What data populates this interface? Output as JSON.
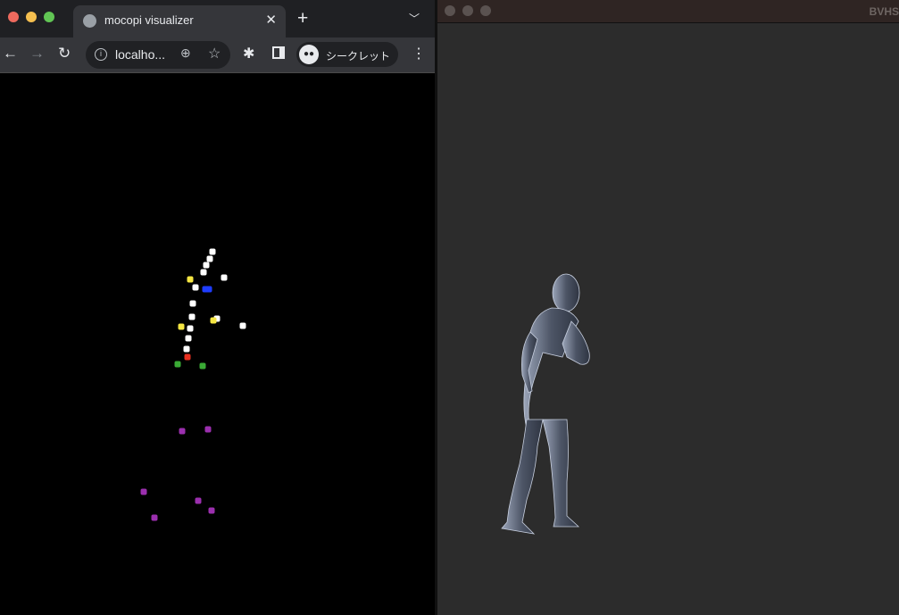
{
  "browser": {
    "tab_title": "mocopi visualizer",
    "url": "localho...",
    "incognito_label": "シークレット",
    "icons": [
      "globe-icon",
      "close-icon",
      "plus-icon",
      "chevron-down-icon",
      "back-icon",
      "forward-icon",
      "reload-icon",
      "info-icon",
      "zoom-icon",
      "star-icon",
      "extensions-icon",
      "sidepanel-icon",
      "incognito-icon",
      "more-icon"
    ],
    "colors": {
      "white": "#ffffff",
      "yellow": "#f5e642",
      "blue": "#1e3cff",
      "red": "#e83020",
      "green": "#3aaa35",
      "purple": "#9b2fae"
    }
  },
  "bvh_window": {
    "title": "BVHS"
  }
}
